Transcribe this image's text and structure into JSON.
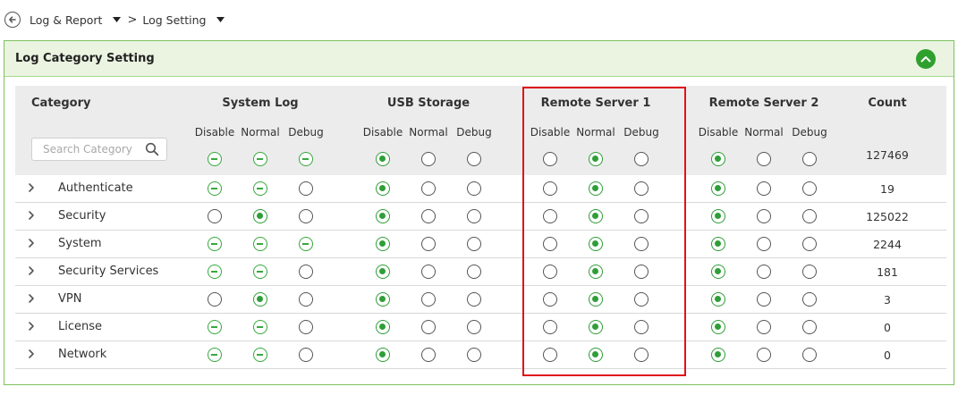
{
  "breadcrumb": {
    "item1": "Log & Report",
    "item2": "Log Setting",
    "separator": ">"
  },
  "panel": {
    "title": "Log Category Setting"
  },
  "table": {
    "category_header": "Category",
    "search_placeholder": "Search Category",
    "count_header": "Count",
    "groups": [
      {
        "label": "System Log",
        "subs": [
          "Disable",
          "Normal",
          "Debug"
        ]
      },
      {
        "label": "USB Storage",
        "subs": [
          "Disable",
          "Normal",
          "Debug"
        ]
      },
      {
        "label": "Remote Server 1",
        "subs": [
          "Disable",
          "Normal",
          "Debug"
        ]
      },
      {
        "label": "Remote Server 2",
        "subs": [
          "Disable",
          "Normal",
          "Debug"
        ]
      }
    ],
    "all_row": {
      "count": "127469",
      "states": [
        "na",
        "na",
        "na",
        "sel",
        "un",
        "un",
        "un",
        "sel",
        "un",
        "sel",
        "un",
        "un"
      ]
    },
    "rows": [
      {
        "name": "Authenticate",
        "count": "19",
        "states": [
          "na",
          "na",
          "un",
          "sel",
          "un",
          "un",
          "un",
          "sel",
          "un",
          "sel",
          "un",
          "un"
        ]
      },
      {
        "name": "Security",
        "count": "125022",
        "states": [
          "un",
          "sel",
          "un",
          "sel",
          "un",
          "un",
          "un",
          "sel",
          "un",
          "sel",
          "un",
          "un"
        ]
      },
      {
        "name": "System",
        "count": "2244",
        "states": [
          "na",
          "na",
          "na",
          "sel",
          "un",
          "un",
          "un",
          "sel",
          "un",
          "sel",
          "un",
          "un"
        ]
      },
      {
        "name": "Security Services",
        "count": "181",
        "states": [
          "na",
          "na",
          "un",
          "sel",
          "un",
          "un",
          "un",
          "sel",
          "un",
          "sel",
          "un",
          "un"
        ]
      },
      {
        "name": "VPN",
        "count": "3",
        "states": [
          "un",
          "sel",
          "un",
          "sel",
          "un",
          "un",
          "un",
          "sel",
          "un",
          "sel",
          "un",
          "un"
        ]
      },
      {
        "name": "License",
        "count": "0",
        "states": [
          "na",
          "na",
          "un",
          "sel",
          "un",
          "un",
          "un",
          "sel",
          "un",
          "sel",
          "un",
          "un"
        ]
      },
      {
        "name": "Network",
        "count": "0",
        "states": [
          "na",
          "na",
          "un",
          "sel",
          "un",
          "un",
          "un",
          "sel",
          "un",
          "sel",
          "un",
          "un"
        ]
      }
    ]
  },
  "colors": {
    "accent": "#2f9e38",
    "panel_border": "#7dc160",
    "header_bg": "#ebf4e1",
    "highlight": "#e0111b"
  }
}
